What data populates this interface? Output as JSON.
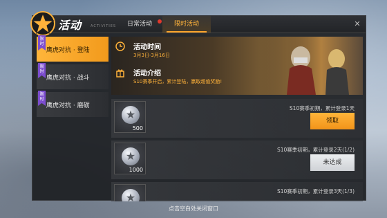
{
  "header": {
    "title": "活动",
    "title_sub": "ACTIVITIES",
    "tabs": [
      {
        "label": "日常活动",
        "has_notification": true
      },
      {
        "label": "限时活动",
        "active": true
      }
    ]
  },
  "sidebar": {
    "items": [
      {
        "badge": "限时",
        "label": "鹰虎对抗 · 登陆",
        "active": true
      },
      {
        "badge": "限时",
        "label": "鹰虎对抗 · 战斗",
        "active": false
      },
      {
        "badge": "限时",
        "label": "鹰虎对抗 · 磨砺",
        "active": false
      }
    ]
  },
  "banner": {
    "time_title": "活动时间",
    "time_value": "3月3日-3月16日",
    "intro_title": "活动介绍",
    "intro_value": "S10赛季开启，累计登陆，赢取超值奖励!"
  },
  "rewards": [
    {
      "title": "S10赛季初期，累计登录1天",
      "amount": "500",
      "button": "领取",
      "state": "claimable"
    },
    {
      "title": "S10赛季初期，累计登录2天(1/2)",
      "amount": "1000",
      "button": "未达成",
      "state": "locked"
    },
    {
      "title": "S10赛季初期，累计登录3天(1/3)",
      "amount": "",
      "button": "",
      "state": "locked"
    }
  ],
  "footer": {
    "hint": "点击空白处关闭窗口"
  },
  "colors": {
    "accent": "#ffa62b",
    "badge": "#7c4dcf",
    "notification": "#e0382c"
  }
}
